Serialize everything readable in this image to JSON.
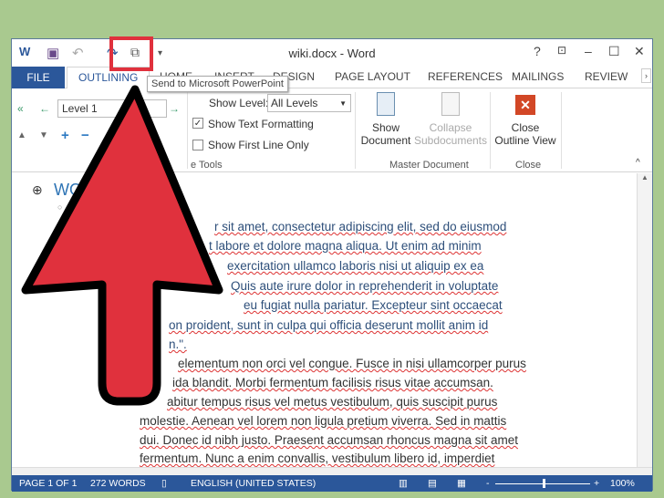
{
  "window": {
    "title": "wiki.docx - Word",
    "help": "?",
    "minimize": "–",
    "maximize": "☐",
    "close": "✕"
  },
  "tabs": {
    "file": "FILE",
    "outlining": "OUTLINING",
    "home": "HOME",
    "insert": "INSERT",
    "design": "DESIGN",
    "page_layout": "PAGE LAYOUT",
    "references": "REFERENCES",
    "mailings": "MAILINGS",
    "review": "REVIEW"
  },
  "tooltip": "Send to Microsoft PowerPoint",
  "ribbon": {
    "level_value": "Level 1",
    "show_level_label": "Show Level:",
    "show_level_value": "All Levels",
    "show_text_formatting": "Show Text Formatting",
    "show_text_formatting_checked": true,
    "show_first_line_only": "Show First Line Only",
    "show_first_line_only_checked": false,
    "outline_tools_group": "e Tools",
    "show_document_1": "Show",
    "show_document_2": "Document",
    "collapse_1": "Collapse",
    "collapse_2": "Subdocuments",
    "master_document_group": "Master Document",
    "close_1": "Close",
    "close_2": "Outline View",
    "close_group": "Close"
  },
  "document": {
    "heading": "WO",
    "lines": [
      "r sit amet, consectetur adipiscing elit, sed do eiusmod",
      "t labore et dolore magna aliqua. Ut enim ad minim",
      "exercitation ullamco laboris nisi ut aliquip ex ea",
      "Quis aute irure dolor in reprehenderit in voluptate",
      "eu fugiat nulla pariatur. Excepteur sint occaecat",
      "on proident, sunt in culpa qui officia deserunt mollit anim id",
      "n.\"."
    ],
    "lines2": [
      "elementum non orci vel congue. Fusce in nisi ullamcorper purus",
      "ida blandit. Morbi fermentum facilisis risus vitae accumsan.",
      "abitur tempus risus vel metus vestibulum, quis suscipit purus",
      "molestie. Aenean vel lorem non ligula pretium viverra. Sed in mattis",
      "dui. Donec id nibh justo. Praesent accumsan rhoncus magna sit amet",
      "fermentum. Nunc a enim convallis, vestibulum libero id, imperdiet"
    ]
  },
  "status": {
    "page": "PAGE 1 OF 1",
    "words": "272 WORDS",
    "language": "ENGLISH (UNITED STATES)",
    "zoom": "100%",
    "zoom_minus": "-",
    "zoom_plus": "+"
  },
  "colors": {
    "accent": "#2b579a",
    "arrow": "#e0313d",
    "background": "#a9c98f"
  }
}
